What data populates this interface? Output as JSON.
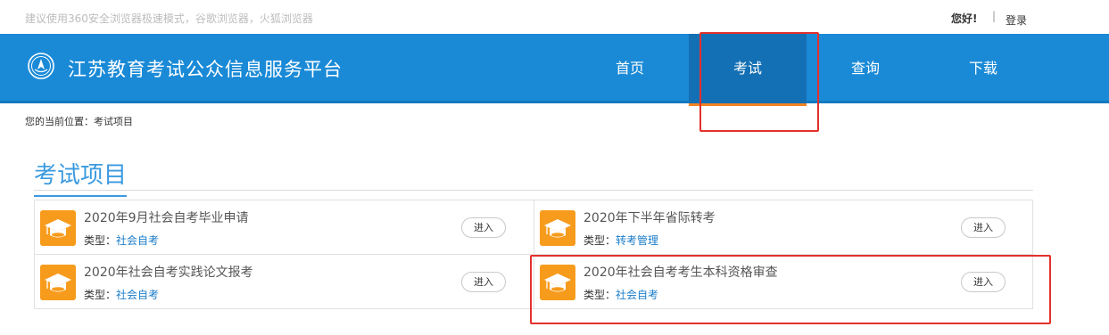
{
  "topbar": {
    "notice": "建议使用360安全浏览器极速模式，谷歌浏览器，火狐浏览器",
    "greeting": "您好!",
    "separator": "|",
    "login": "登录"
  },
  "header": {
    "site_title": "江苏教育考试公众信息服务平台",
    "nav": [
      {
        "label": "首页"
      },
      {
        "label": "考试"
      },
      {
        "label": "查询"
      },
      {
        "label": "下载"
      }
    ],
    "active_index": 1
  },
  "breadcrumb": "您的当前位置：考试项目",
  "section_title": "考试项目",
  "type_prefix": "类型：",
  "projects": [
    {
      "title": "2020年9月社会自考毕业申请",
      "type": "社会自考",
      "button": "进入"
    },
    {
      "title": "2020年下半年省际转考",
      "type": "转考管理",
      "button": "进入"
    },
    {
      "title": "2020年社会自考实践论文报考",
      "type": "社会自考",
      "button": "进入"
    },
    {
      "title": "2020年社会自考考生本科资格审查",
      "type": "社会自考",
      "button": "进入"
    }
  ],
  "colors": {
    "header_blue": "#1a8ad7",
    "active_nav": "#1470b4",
    "accent_orange": "#f08423",
    "icon_orange": "#f79b1c",
    "highlight_red": "#e3312d",
    "link_blue": "#1a7cc9"
  },
  "icons": {
    "logo": "emblem-icon",
    "card": "graduation-cap-icon"
  }
}
